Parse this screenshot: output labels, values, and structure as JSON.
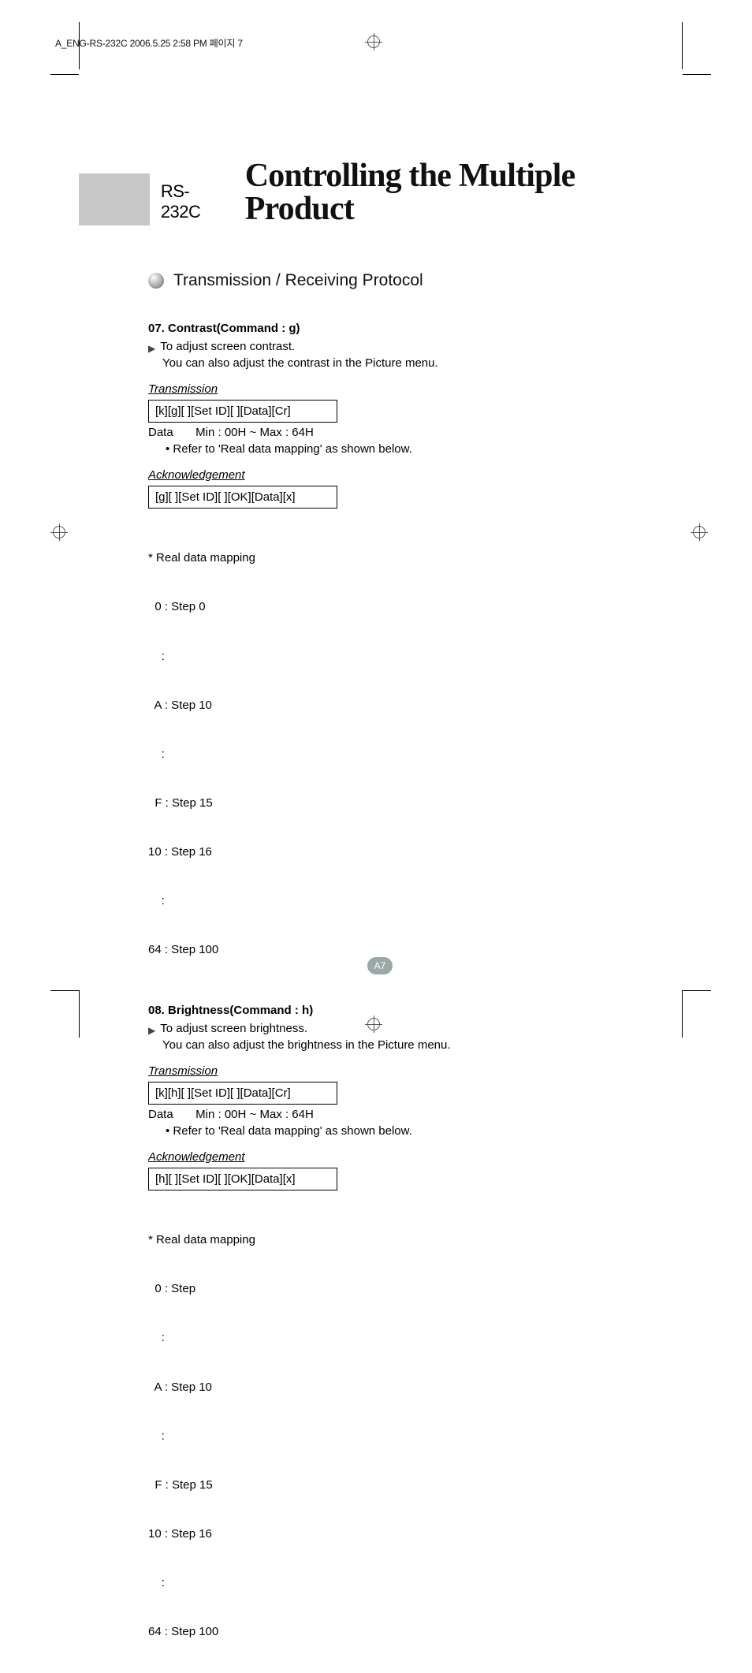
{
  "header_strip": "A_ENG-RS-232C  2006.5.25  2:58 PM  페이지 7",
  "title": {
    "pretitle": "RS-232C",
    "main": "Controlling the Multiple Product"
  },
  "section_header": "Transmission / Receiving Protocol",
  "sections": [
    {
      "heading": "07. Contrast(Command : g)",
      "desc_line1": "To adjust screen contrast.",
      "desc_line2": "You can also adjust the contrast in the Picture menu.",
      "transmission_label": "Transmission",
      "transmission_cmd": "[k][g][ ][Set ID][ ][Data][Cr]",
      "data_label": "Data",
      "data_range": "Min : 00H ~ Max : 64H",
      "data_note": "• Refer to 'Real data mapping' as shown below.",
      "ack_label": "Acknowledgement",
      "ack_cmd": "[g][ ][Set ID][ ][OK][Data][x]",
      "mapping_title": "* Real data mapping",
      "mapping_lines": [
        "  0 : Step 0",
        "    :",
        "  A : Step 10",
        "    :",
        "  F : Step 15",
        "10 : Step 16",
        "    :",
        "64 : Step 100"
      ]
    },
    {
      "heading": "08. Brightness(Command : h)",
      "desc_line1": "To adjust screen brightness.",
      "desc_line2": "You can also adjust the brightness in the Picture menu.",
      "transmission_label": "Transmission",
      "transmission_cmd": "[k][h][ ][Set ID][ ][Data][Cr]",
      "data_label": "Data",
      "data_range": "Min : 00H ~ Max : 64H",
      "data_note": "• Refer to 'Real data mapping' as shown below.",
      "ack_label": "Acknowledgement",
      "ack_cmd": "[h][ ][Set ID][ ][OK][Data][x]",
      "mapping_title": "* Real data mapping",
      "mapping_lines": [
        "  0 : Step",
        "    :",
        "  A : Step 10",
        "    :",
        "  F : Step 15",
        "10 : Step 16",
        "    :",
        "64 : Step 100"
      ]
    }
  ],
  "page_number": "A7"
}
